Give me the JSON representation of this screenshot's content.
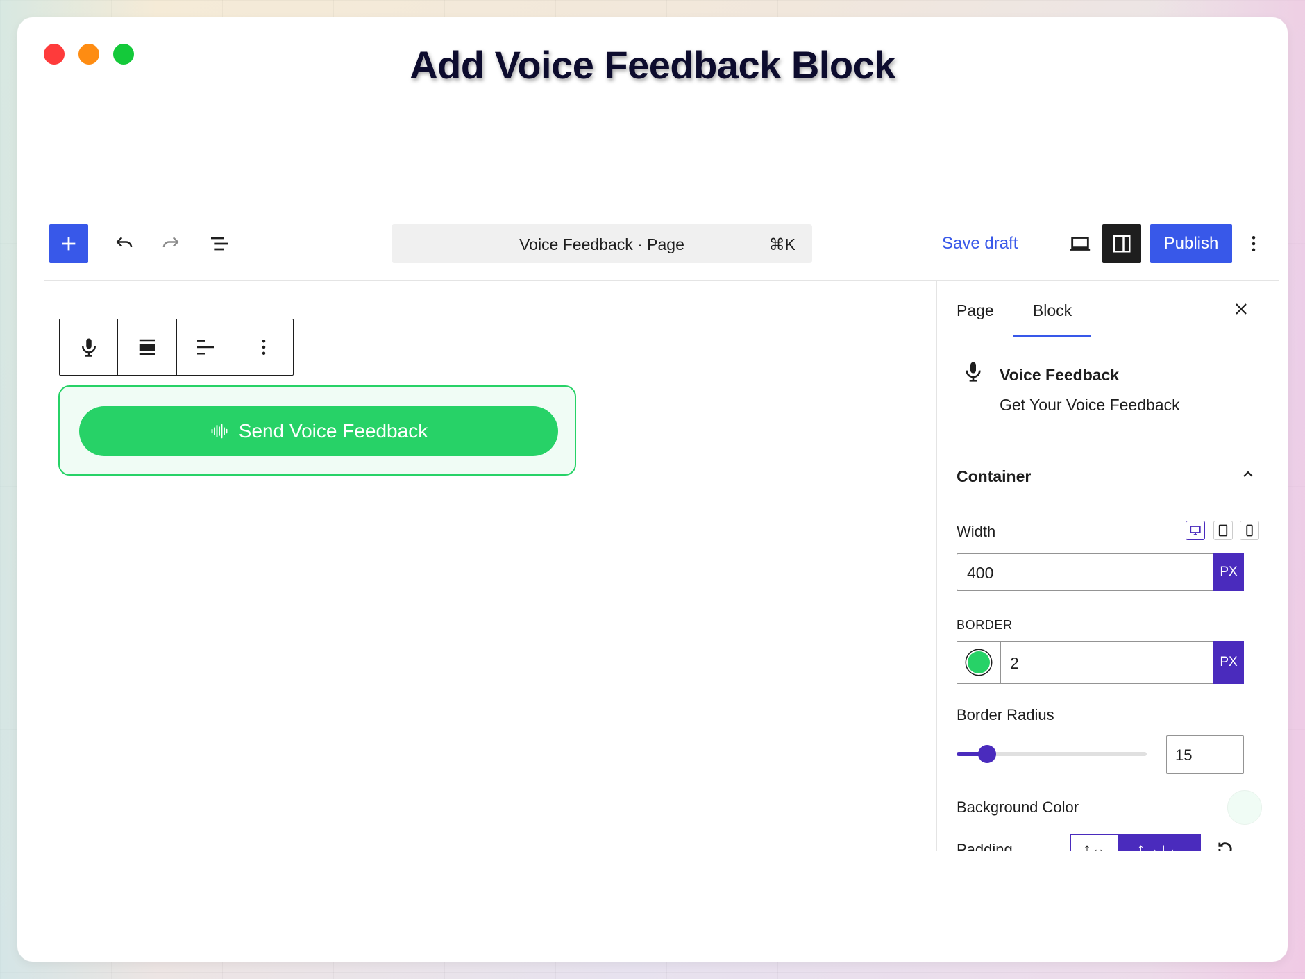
{
  "page_title": "Add Voice Feedback Block",
  "toolbar": {
    "document_title": "Voice Feedback · Page",
    "shortcut": "⌘K",
    "save_draft_label": "Save draft",
    "publish_label": "Publish"
  },
  "block": {
    "button_label": "Send Voice Feedback",
    "button_color": "#27d267",
    "background_color": "#f0fcf5"
  },
  "sidebar": {
    "tabs": [
      {
        "label": "Page",
        "active": false
      },
      {
        "label": "Block",
        "active": true
      }
    ],
    "block_card": {
      "name": "Voice Feedback",
      "description": "Get Your Voice Feedback"
    },
    "container": {
      "title": "Container",
      "width_label": "Width",
      "width_value": "400",
      "width_unit": "PX",
      "border_label": "BORDER",
      "border_value": "2",
      "border_unit": "PX",
      "border_color": "#27d267",
      "radius_label": "Border Radius",
      "radius_value": "15",
      "radius_fraction": 0.16,
      "bg_color_label": "Background Color",
      "padding_label": "Padding",
      "padding_linked_label": "↑↔",
      "padding_sides_label": "↑→↓←"
    }
  },
  "colors": {
    "accent": "#3858e9",
    "brand_purple": "#4a2bbd",
    "success_green": "#27d267"
  }
}
